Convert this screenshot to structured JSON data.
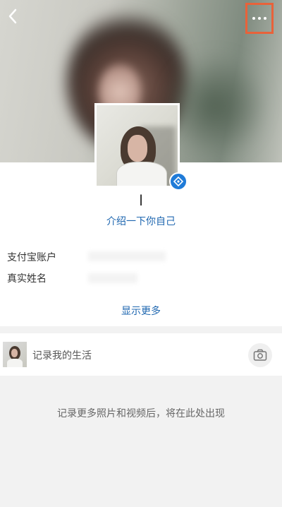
{
  "header": {
    "back_icon": "chevron-left-icon",
    "more_icon": "more-dots-icon",
    "highlight_color": "#e8623a"
  },
  "profile": {
    "name": "l",
    "intro_link": "介绍一下你自己",
    "verified_icon": "verified-badge-icon",
    "accent_color": "#1f67b0"
  },
  "info": {
    "rows": [
      {
        "label": "支付宝账户"
      },
      {
        "label": "真实姓名"
      }
    ],
    "show_more": "显示更多"
  },
  "life": {
    "label": "记录我的生活",
    "camera_icon": "camera-icon"
  },
  "empty_message": "记录更多照片和视频后，将在此处出现"
}
